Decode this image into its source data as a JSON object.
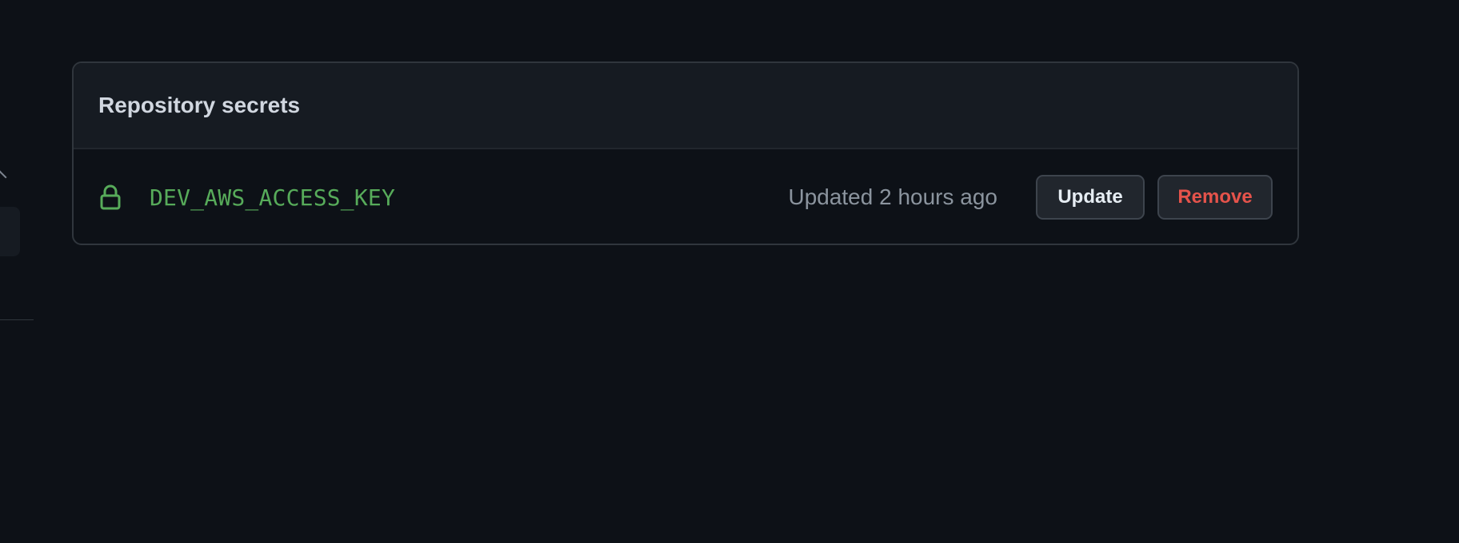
{
  "section": {
    "title": "Repository secrets"
  },
  "secrets": [
    {
      "name": "DEV_AWS_ACCESS_KEY",
      "updated": "Updated 2 hours ago",
      "icon": "lock-icon",
      "update_label": "Update",
      "remove_label": "Remove"
    }
  ],
  "colors": {
    "background": "#0d1117",
    "header_background": "#161b22",
    "secret_name": "#57ab5a",
    "remove_text": "#e5534b",
    "muted_text": "#8b949e"
  }
}
